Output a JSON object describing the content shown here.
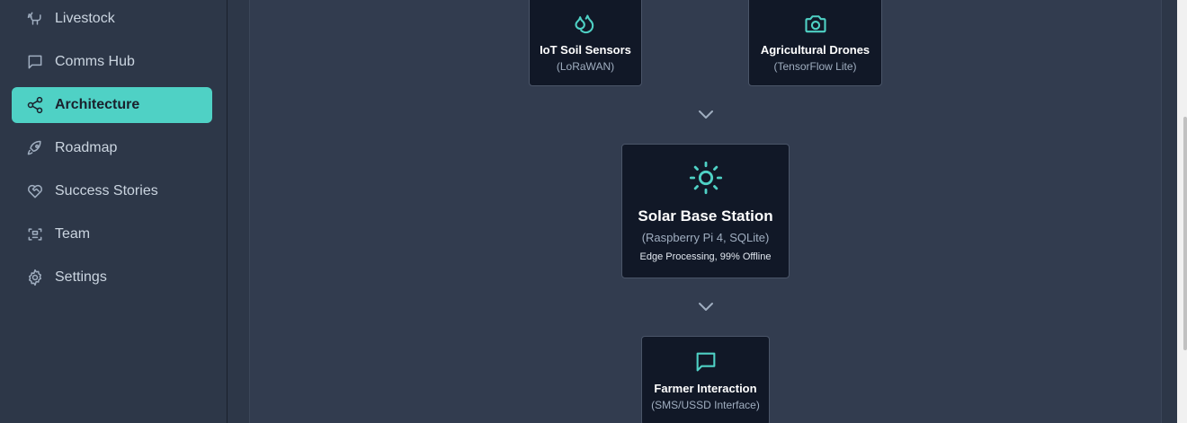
{
  "sidebar": {
    "items": [
      {
        "label": "Livestock",
        "icon": "livestock-icon",
        "active": false
      },
      {
        "label": "Comms Hub",
        "icon": "message-icon",
        "active": false
      },
      {
        "label": "Architecture",
        "icon": "share-icon",
        "active": true
      },
      {
        "label": "Roadmap",
        "icon": "rocket-icon",
        "active": false
      },
      {
        "label": "Success Stories",
        "icon": "heart-handshake-icon",
        "active": false
      },
      {
        "label": "Team",
        "icon": "team-scan-icon",
        "active": false
      },
      {
        "label": "Settings",
        "icon": "gear-icon",
        "active": false
      }
    ]
  },
  "architecture": {
    "sensors": {
      "title": "IoT Soil Sensors",
      "subtitle": "(LoRaWAN)",
      "icon": "droplets-icon"
    },
    "drones": {
      "title": "Agricultural Drones",
      "subtitle": "(TensorFlow Lite)",
      "icon": "camera-icon"
    },
    "base_station": {
      "title": "Solar Base Station",
      "subtitle": "(Raspberry Pi 4, SQLite)",
      "note": "Edge Processing, 99% Offline",
      "icon": "sun-icon"
    },
    "farmer": {
      "title": "Farmer Interaction",
      "subtitle": "(SMS/USSD Interface)",
      "icon": "message-icon"
    }
  },
  "colors": {
    "accent": "#4fd1c5",
    "sidebar_bg": "#2d3748",
    "card_bg": "#111827"
  }
}
